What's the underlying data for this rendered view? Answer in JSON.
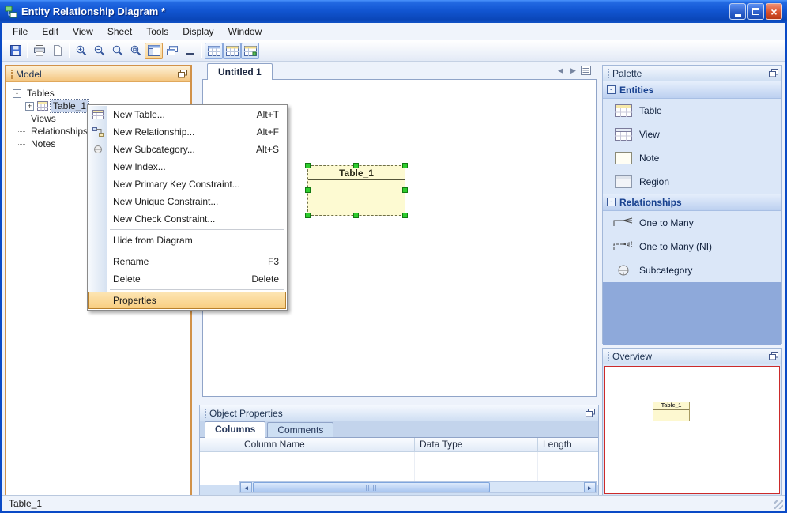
{
  "window": {
    "title": "Entity Relationship Diagram *"
  },
  "menubar": {
    "items": [
      {
        "label": "File"
      },
      {
        "label": "Edit"
      },
      {
        "label": "View"
      },
      {
        "label": "Sheet"
      },
      {
        "label": "Tools"
      },
      {
        "label": "Display"
      },
      {
        "label": "Window"
      }
    ]
  },
  "toolbar": {
    "buttons": [
      {
        "name": "save"
      },
      {
        "name": "print"
      },
      {
        "name": "print-preview"
      },
      {
        "name": "zoom-in"
      },
      {
        "name": "zoom-out"
      },
      {
        "name": "zoom-actual"
      },
      {
        "name": "zoom-selection"
      },
      {
        "name": "toggle-model-panel",
        "active": true
      },
      {
        "name": "float-panels"
      },
      {
        "name": "minimize-panels"
      },
      {
        "name": "toggle-object-properties",
        "active": true
      },
      {
        "name": "toggle-palette",
        "active": true
      },
      {
        "name": "toggle-overview",
        "active": true
      }
    ]
  },
  "model_panel": {
    "title": "Model",
    "tree": [
      {
        "label": "Tables",
        "expander": "-"
      },
      {
        "label": "Table_1",
        "expander": "+",
        "selected": true
      },
      {
        "label": "Views"
      },
      {
        "label": "Relationships"
      },
      {
        "label": "Notes"
      }
    ]
  },
  "context_menu": {
    "items": [
      {
        "label": "New Table...",
        "shortcut": "Alt+T",
        "icon": "table-icon"
      },
      {
        "label": "New Relationship...",
        "shortcut": "Alt+F",
        "icon": "relationship-icon"
      },
      {
        "label": "New Subcategory...",
        "shortcut": "Alt+S",
        "icon": "subcategory-icon"
      },
      {
        "label": "New Index...",
        "shortcut": ""
      },
      {
        "label": "New Primary Key Constraint...",
        "shortcut": ""
      },
      {
        "label": "New Unique Constraint...",
        "shortcut": ""
      },
      {
        "label": "New Check Constraint...",
        "shortcut": ""
      },
      {
        "label": "Hide from Diagram",
        "shortcut": ""
      },
      {
        "label": "Rename",
        "shortcut": "F3"
      },
      {
        "label": "Delete",
        "shortcut": "Delete"
      },
      {
        "label": "Properties",
        "shortcut": "",
        "highlighted": true
      }
    ]
  },
  "canvas": {
    "tab": "Untitled 1",
    "entity": {
      "title": "Table_1"
    }
  },
  "object_properties": {
    "title": "Object Properties",
    "tabs": [
      {
        "label": "Columns",
        "active": true
      },
      {
        "label": "Comments",
        "active": false
      }
    ],
    "columns": [
      {
        "label": "Column Name"
      },
      {
        "label": "Data Type"
      },
      {
        "label": "Length"
      }
    ]
  },
  "palette": {
    "title": "Palette",
    "sections": [
      {
        "title": "Entities",
        "collapse": "-",
        "items": [
          {
            "label": "Table",
            "icon": "table-entity-icon"
          },
          {
            "label": "View",
            "icon": "view-entity-icon"
          },
          {
            "label": "Note",
            "icon": "note-entity-icon"
          },
          {
            "label": "Region",
            "icon": "region-entity-icon"
          }
        ]
      },
      {
        "title": "Relationships",
        "collapse": "-",
        "items": [
          {
            "label": "One to Many",
            "icon": "one-to-many-icon"
          },
          {
            "label": "One to Many (NI)",
            "icon": "one-to-many-ni-icon"
          },
          {
            "label": "Subcategory",
            "icon": "subcategory-rel-icon"
          }
        ]
      }
    ]
  },
  "overview": {
    "title": "Overview",
    "entity": "Table_1"
  },
  "statusbar": {
    "text": "Table_1"
  }
}
